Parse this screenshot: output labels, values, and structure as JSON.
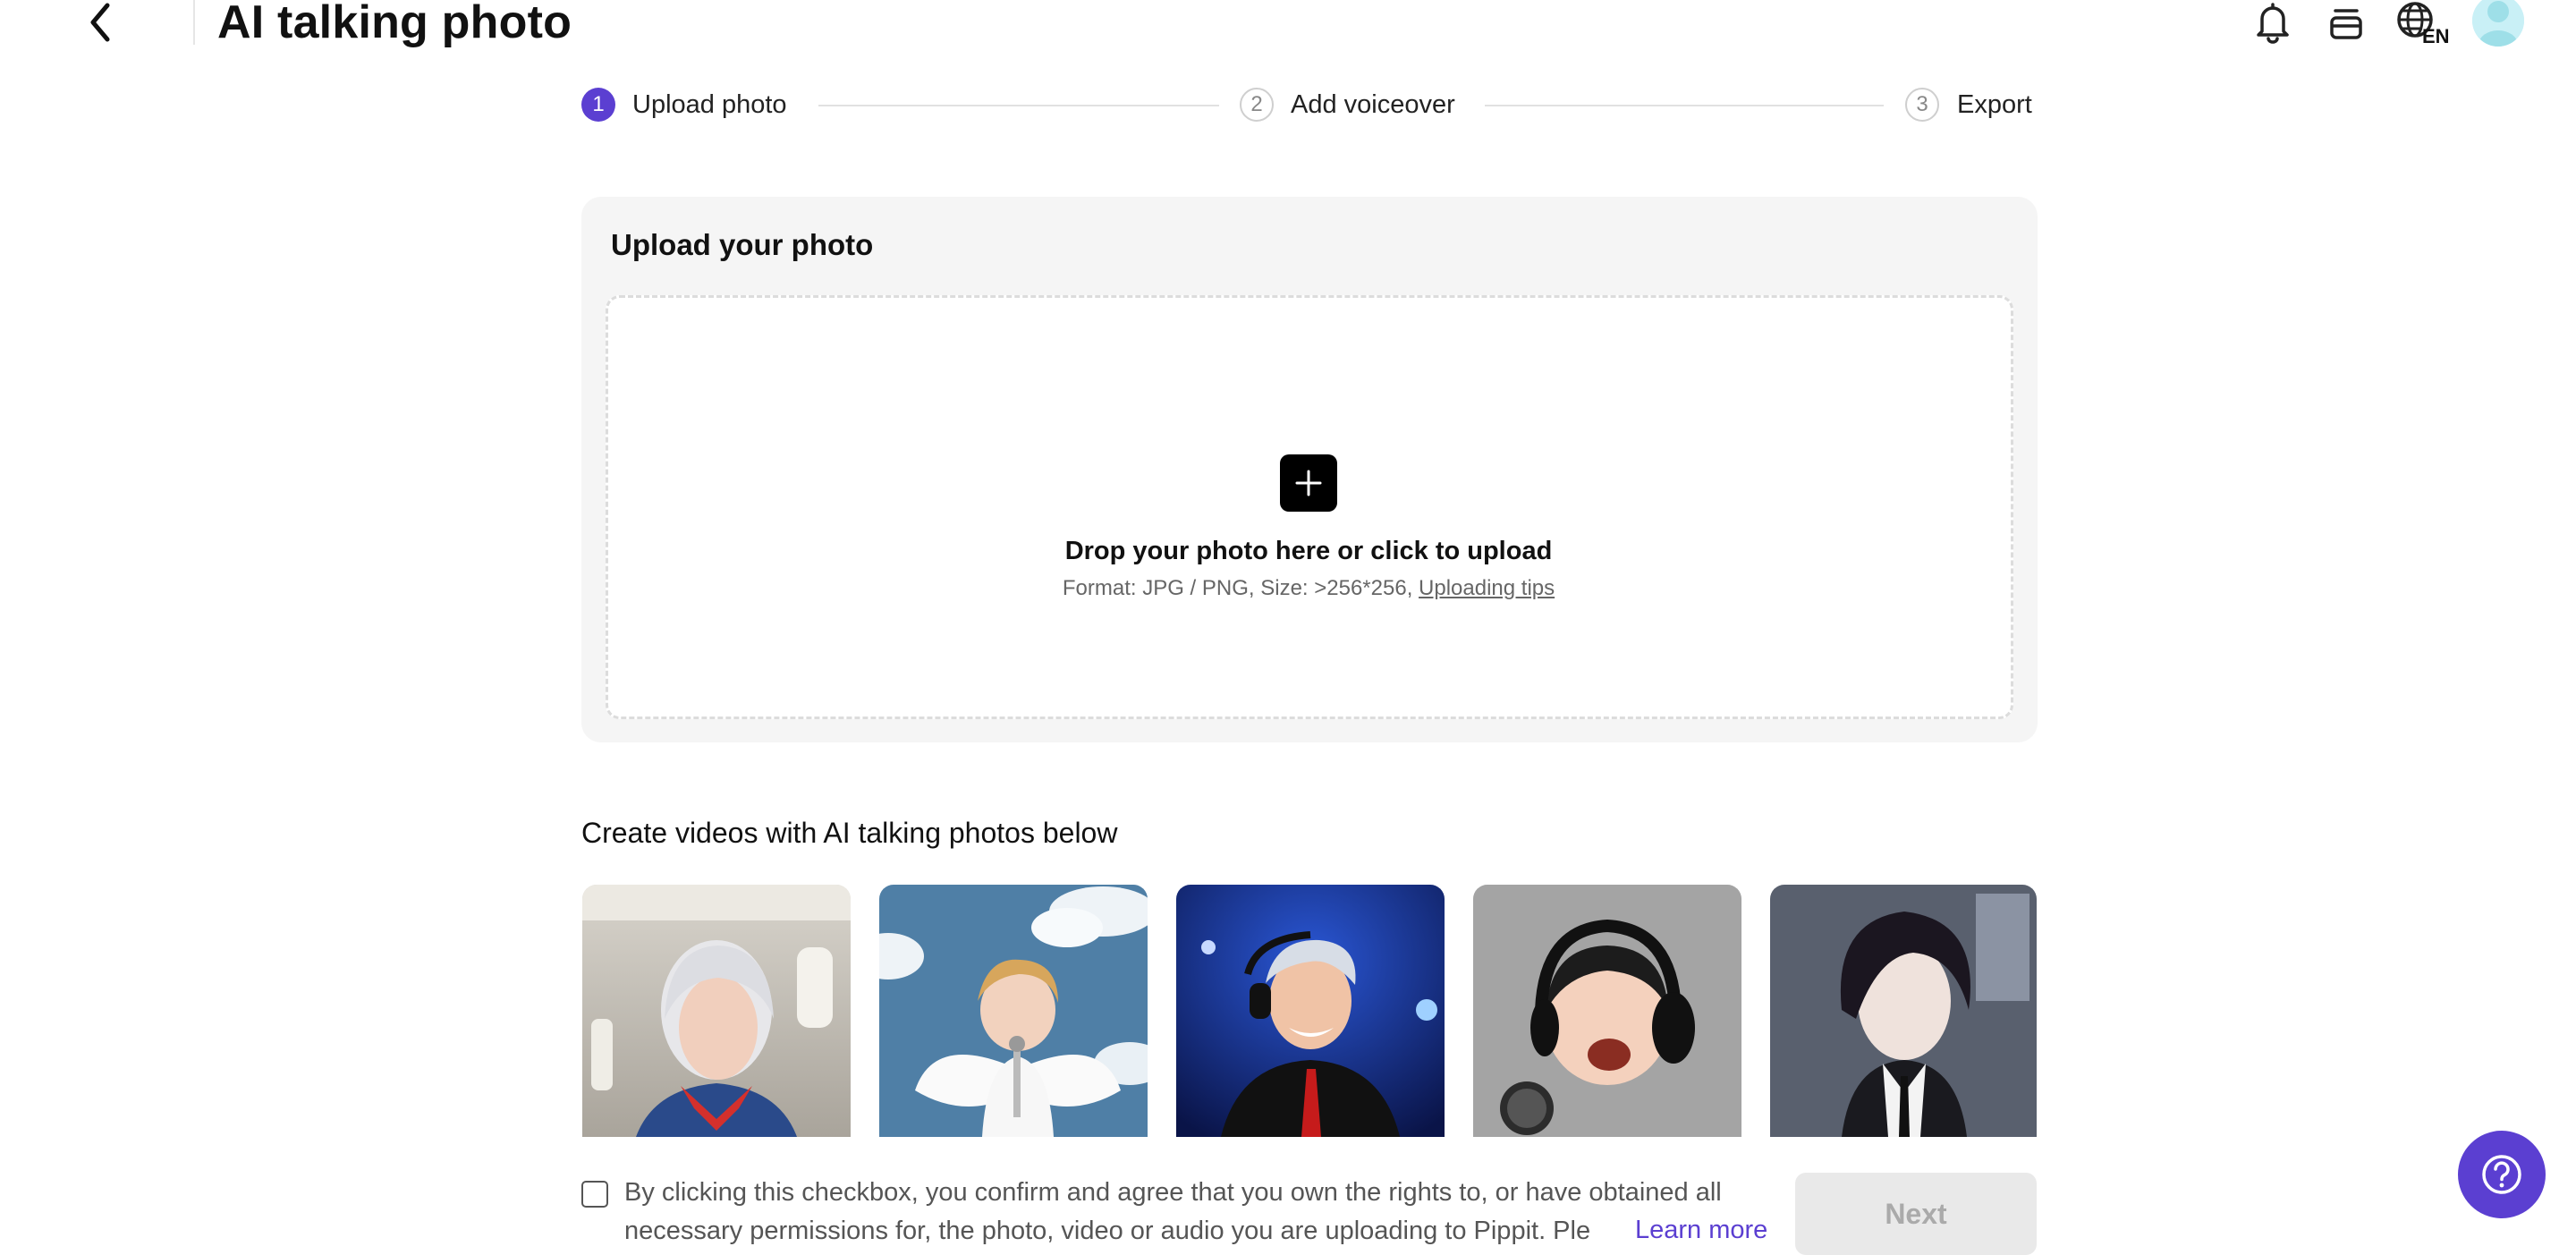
{
  "header": {
    "title": "AI talking photo",
    "language_badge": "EN",
    "icons": [
      "back-arrow-icon",
      "bell-icon",
      "credits-icon",
      "language-globe-icon",
      "avatar"
    ]
  },
  "stepper": {
    "steps": [
      {
        "number": "1",
        "label": "Upload photo",
        "state": "active"
      },
      {
        "number": "2",
        "label": "Add voiceover",
        "state": "inactive"
      },
      {
        "number": "3",
        "label": "Export",
        "state": "inactive"
      }
    ]
  },
  "upload": {
    "title": "Upload your photo",
    "drop_text": "Drop your photo here or click to upload",
    "format_text": "Format: JPG / PNG, Size: >256*256, ",
    "tips_link": "Uploading tips"
  },
  "gallery": {
    "title": "Create videos with AI talking photos below",
    "items": [
      "flight-attendant-photo",
      "angel-child-photo",
      "singer-headphones-photo",
      "baby-headphones-photo",
      "anime-boy-photo"
    ]
  },
  "footer": {
    "consent_line1": "By clicking this checkbox, you confirm and agree that you own the rights to, or have obtained all",
    "consent_line2": "necessary permissions for, the photo, video or audio you are uploading to Pippit. Ple",
    "learn_more": "Learn more",
    "next_label": "Next",
    "checkbox_checked": false
  },
  "colors": {
    "accent": "#5b3fd1",
    "card_bg": "#f5f5f5",
    "disabled_button": "#e9e9e9"
  }
}
